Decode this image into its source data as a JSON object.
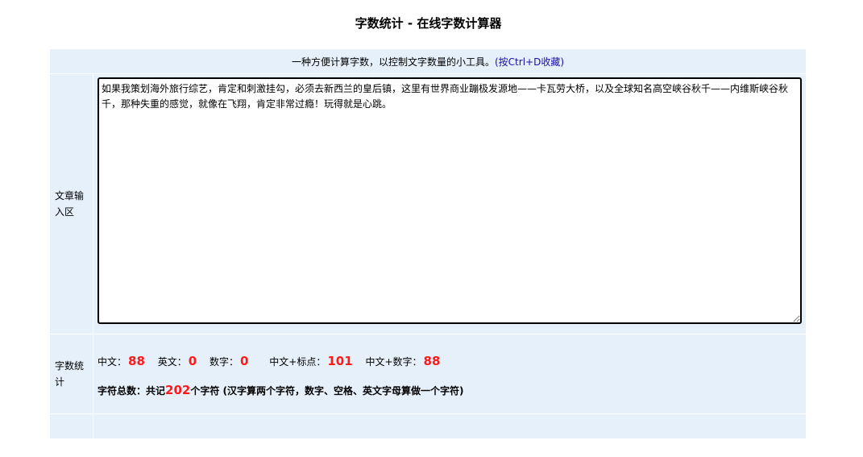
{
  "title": "字数统计 - 在线字数计算器",
  "intro": {
    "text": "一种方便计算字数，以控制文字数量的小工具。",
    "link": "(按Ctrl+D收藏)"
  },
  "article": {
    "label": "文章输入区",
    "value": "如果我策划海外旅行综艺，肯定和刺激挂勾，必须去新西兰的皇后镇，这里有世界商业蹦极发源地——卡瓦劳大桥，以及全球知名高空峡谷秋千——内维斯峡谷秋千，那种失重的感觉，就像在飞翔，肯定非常过瘾！玩得就是心跳。"
  },
  "stats": {
    "label": "字数统计",
    "chinese_label": "中文：",
    "chinese": "88",
    "english_label": "英文：",
    "english": "0",
    "digits_label": "数字：",
    "digits": "0",
    "chinese_punct_label": "中文+标点：",
    "chinese_punct": "101",
    "chinese_digits_label": "中文+数字：",
    "chinese_digits": "88",
    "total_prefix": "字符总数：共记",
    "total": "202",
    "total_suffix": "个字符 (汉字算两个字符，数字、空格、英文字母算做一个字符)"
  }
}
